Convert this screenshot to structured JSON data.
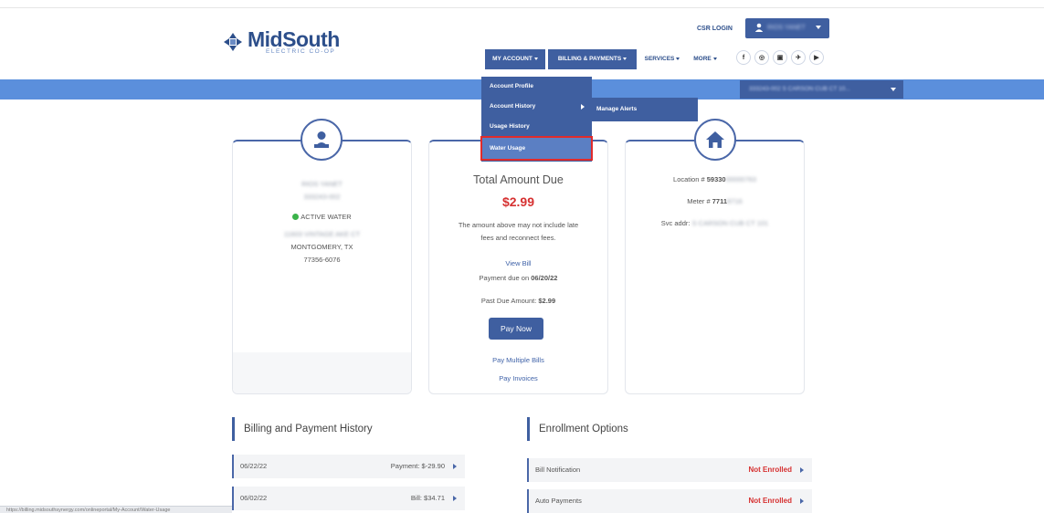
{
  "brand": {
    "name": "MidSouth",
    "subtitle": "ELECTRIC CO-OP"
  },
  "header": {
    "csr_login": "CSR LOGIN",
    "user_name": "RIOS YANET"
  },
  "nav": [
    {
      "label": "MY ACCOUNT",
      "active": true
    },
    {
      "label": "BILLING & PAYMENTS",
      "active": true
    },
    {
      "label": "SERVICES",
      "active": false
    },
    {
      "label": "MORE",
      "active": false
    }
  ],
  "social": [
    "f",
    "◎",
    "▣",
    "✈",
    "▶"
  ],
  "account_select": {
    "value": "333243-002 S CARSON CUB CT 10..."
  },
  "dropdown": {
    "items": [
      "Account Profile",
      "Account History",
      "Usage History",
      "Water Usage"
    ],
    "highlighted": "Water Usage",
    "submenu": "Manage Alerts"
  },
  "customer_card": {
    "name": "RIOS YANET",
    "account_no": "333243-002",
    "status": "ACTIVE WATER",
    "street": "11603 VINTAGE AKE CT",
    "city": "MONTGOMERY, TX",
    "zip": "77356-6076"
  },
  "amount_card": {
    "label": "Total Amount Due",
    "amount": "$2.99",
    "note_line1": "The amount above may not include late",
    "note_line2": "fees and reconnect fees.",
    "view_bill": "View Bill",
    "due_prefix": "Payment due on ",
    "due_date": "06/20/22",
    "past_due_prefix": "Past Due Amount: ",
    "past_due": "$2.99",
    "pay_now": "Pay Now",
    "pay_multiple": "Pay Multiple Bills",
    "pay_invoices": "Pay Invoices"
  },
  "location_card": {
    "location_prefix": "Location # ",
    "location_visible": "59330",
    "location_hidden": "00000763",
    "meter_prefix": "Meter # ",
    "meter_visible": "7711",
    "meter_hidden": "8716",
    "svc_prefix": "Svc addr: ",
    "svc_hidden": "S CARSON CUB CT 101"
  },
  "billing_history": {
    "title": "Billing and Payment History",
    "rows": [
      {
        "date": "06/22/22",
        "value": "Payment: $-29.90"
      },
      {
        "date": "06/02/22",
        "value": "Bill: $34.71"
      }
    ]
  },
  "enrollment": {
    "title": "Enrollment Options",
    "rows": [
      {
        "label": "Bill Notification",
        "status": "Not Enrolled"
      },
      {
        "label": "Auto Payments",
        "status": "Not Enrolled"
      }
    ]
  },
  "status_bar": "https://billing.midsouthsynergy.com/onlineportal/My-Account/Water-Usage",
  "colors": {
    "primary": "#3f5fa0",
    "band": "#5b8fdc",
    "danger": "#d63131",
    "active": "#3bb34a"
  }
}
